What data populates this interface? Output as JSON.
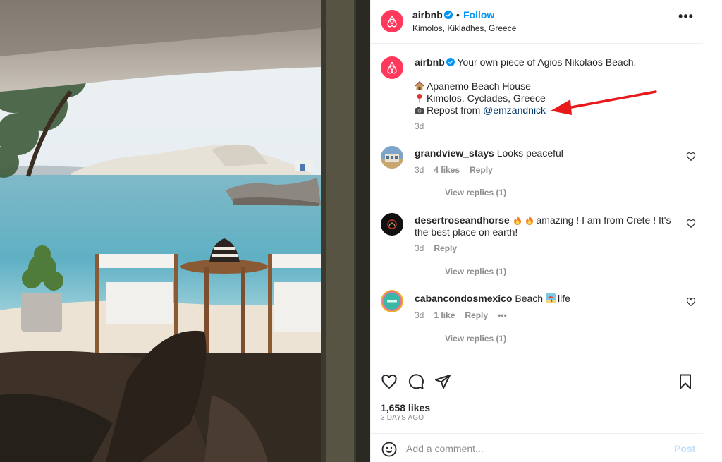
{
  "post": {
    "username": "airbnb",
    "follow_label": "Follow",
    "dot": "•",
    "location": "Kimolos, Kikladhes, Greece",
    "more_label": "•••"
  },
  "caption": {
    "username": "airbnb",
    "text": "Your own piece of Agios Nikolaos Beach.",
    "lines": [
      {
        "icon": "house-icon",
        "text": "Apanemo Beach House"
      },
      {
        "icon": "round-pushpin-icon",
        "text": "Kimolos, Cyclades, Greece"
      },
      {
        "icon": "camera-icon",
        "text": "Repost from",
        "mention": "@emzandnick"
      }
    ],
    "time": "3d"
  },
  "comments": [
    {
      "username": "grandview_stays",
      "text": "Looks peaceful",
      "time": "3d",
      "likes": "4 likes",
      "reply": "Reply",
      "view_replies": "View replies (1)"
    },
    {
      "username": "desertroseandhorse",
      "text_after_emoji": "amazing ! I am from Crete ! It's the best place on earth!",
      "emoji": [
        "fire-icon",
        "fire-icon"
      ],
      "time": "3d",
      "reply": "Reply",
      "view_replies": "View replies (1)"
    },
    {
      "username": "cabancondosmexico",
      "text_before_emoji": "Beach",
      "emoji": "beach-umbrella-icon",
      "text_after_emoji": "life",
      "time": "3d",
      "likes": "1 like",
      "reply": "Reply",
      "more": "•••",
      "view_replies": "View replies (1)"
    }
  ],
  "engagement": {
    "likes": "1,658 likes",
    "date": "3 DAYS AGO"
  },
  "comment_box": {
    "placeholder": "Add a comment...",
    "post_label": "Post"
  },
  "colors": {
    "brand": "#ff385c",
    "link": "#0095f6",
    "mention": "#00376b",
    "annotation_arrow": "#e8191b"
  }
}
